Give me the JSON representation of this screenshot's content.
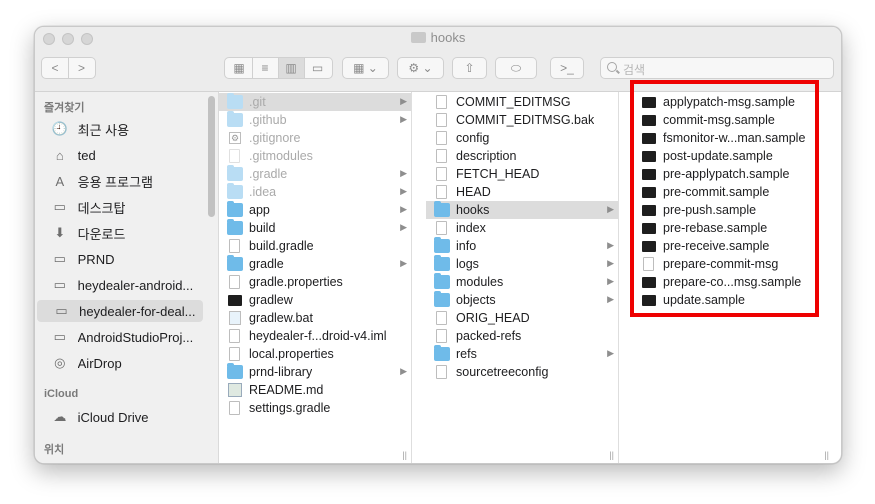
{
  "window": {
    "title": "hooks"
  },
  "toolbar": {
    "back": "<",
    "forward": ">",
    "view_icons": [
      "icon-view-icon",
      "list-view-icon",
      "column-view-icon",
      "gallery-view-icon"
    ],
    "search_placeholder": "검색"
  },
  "sidebar": {
    "favorites_heading": "즐겨찾기",
    "favorites": [
      {
        "label": "최근 사용",
        "icon": "recents-icon"
      },
      {
        "label": "ted",
        "icon": "home-icon"
      },
      {
        "label": "응용 프로그램",
        "icon": "applications-icon"
      },
      {
        "label": "데스크탑",
        "icon": "desktop-icon"
      },
      {
        "label": "다운로드",
        "icon": "downloads-icon"
      },
      {
        "label": "PRND",
        "icon": "folder-icon"
      },
      {
        "label": "heydealer-android...",
        "icon": "folder-icon"
      },
      {
        "label": "heydealer-for-deal...",
        "icon": "folder-icon",
        "selected": true
      },
      {
        "label": "AndroidStudioProj...",
        "icon": "folder-icon"
      },
      {
        "label": "AirDrop",
        "icon": "airdrop-icon"
      }
    ],
    "icloud_heading": "iCloud",
    "icloud": [
      {
        "label": "iCloud Drive",
        "icon": "cloud-icon"
      }
    ],
    "locations_heading": "위치"
  },
  "columns": [
    {
      "items": [
        {
          "name": ".git",
          "type": "folder",
          "dim": true,
          "selected": true,
          "arrow": true
        },
        {
          "name": ".github",
          "type": "folder",
          "dim": true,
          "arrow": true
        },
        {
          "name": ".gitignore",
          "type": "gear",
          "dim": true
        },
        {
          "name": ".gitmodules",
          "type": "doc",
          "dim": true
        },
        {
          "name": ".gradle",
          "type": "folder",
          "dim": true,
          "arrow": true
        },
        {
          "name": ".idea",
          "type": "folder",
          "dim": true,
          "arrow": true
        },
        {
          "name": "app",
          "type": "folder",
          "arrow": true
        },
        {
          "name": "build",
          "type": "folder",
          "arrow": true
        },
        {
          "name": "build.gradle",
          "type": "doc"
        },
        {
          "name": "gradle",
          "type": "folder",
          "arrow": true
        },
        {
          "name": "gradle.properties",
          "type": "doc"
        },
        {
          "name": "gradlew",
          "type": "exec"
        },
        {
          "name": "gradlew.bat",
          "type": "bat"
        },
        {
          "name": "heydealer-f...droid-v4.iml",
          "type": "doc"
        },
        {
          "name": "local.properties",
          "type": "doc"
        },
        {
          "name": "prnd-library",
          "type": "folder",
          "arrow": true
        },
        {
          "name": "README.md",
          "type": "md"
        },
        {
          "name": "settings.gradle",
          "type": "doc"
        }
      ]
    },
    {
      "items": [
        {
          "name": "COMMIT_EDITMSG",
          "type": "doc"
        },
        {
          "name": "COMMIT_EDITMSG.bak",
          "type": "doc"
        },
        {
          "name": "config",
          "type": "doc"
        },
        {
          "name": "description",
          "type": "doc"
        },
        {
          "name": "FETCH_HEAD",
          "type": "doc"
        },
        {
          "name": "HEAD",
          "type": "doc"
        },
        {
          "name": "hooks",
          "type": "folder",
          "selected": true,
          "arrow": true
        },
        {
          "name": "index",
          "type": "doc"
        },
        {
          "name": "info",
          "type": "folder",
          "arrow": true
        },
        {
          "name": "logs",
          "type": "folder",
          "arrow": true
        },
        {
          "name": "modules",
          "type": "folder",
          "arrow": true
        },
        {
          "name": "objects",
          "type": "folder",
          "arrow": true
        },
        {
          "name": "ORIG_HEAD",
          "type": "doc"
        },
        {
          "name": "packed-refs",
          "type": "doc"
        },
        {
          "name": "refs",
          "type": "folder",
          "arrow": true
        },
        {
          "name": "sourcetreeconfig",
          "type": "doc"
        }
      ]
    },
    {
      "items": [
        {
          "name": "applypatch-msg.sample",
          "type": "exec"
        },
        {
          "name": "commit-msg.sample",
          "type": "exec"
        },
        {
          "name": "fsmonitor-w...man.sample",
          "type": "exec"
        },
        {
          "name": "post-update.sample",
          "type": "exec"
        },
        {
          "name": "pre-applypatch.sample",
          "type": "exec"
        },
        {
          "name": "pre-commit.sample",
          "type": "exec"
        },
        {
          "name": "pre-push.sample",
          "type": "exec"
        },
        {
          "name": "pre-rebase.sample",
          "type": "exec"
        },
        {
          "name": "pre-receive.sample",
          "type": "exec"
        },
        {
          "name": "prepare-commit-msg",
          "type": "doc"
        },
        {
          "name": "prepare-co...msg.sample",
          "type": "exec"
        },
        {
          "name": "update.sample",
          "type": "exec"
        }
      ]
    }
  ],
  "colors": {
    "highlight": "#ee0000",
    "folder": "#6fbbe9",
    "selection": "#dcdcdc"
  }
}
